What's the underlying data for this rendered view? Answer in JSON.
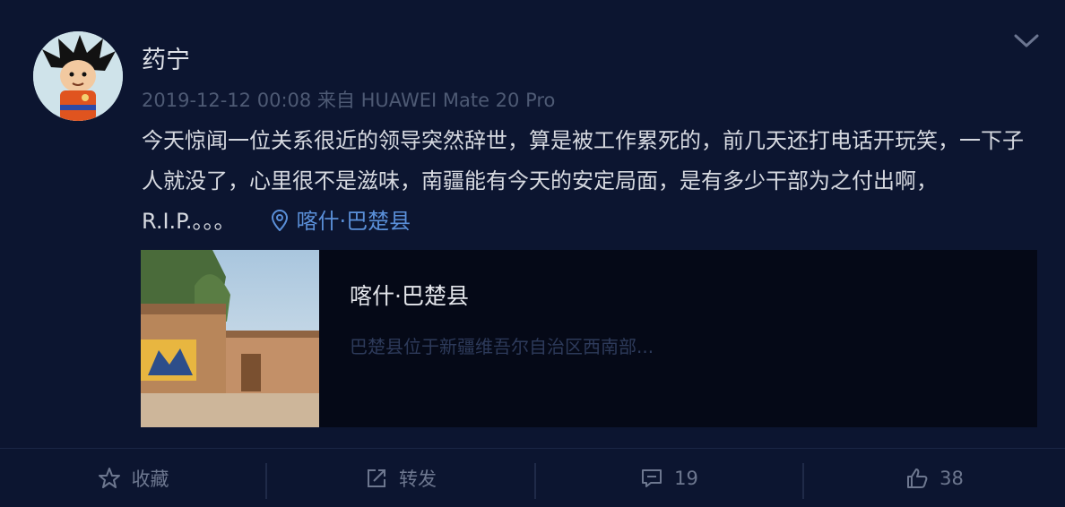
{
  "post": {
    "username": "药宁",
    "meta": "2019-12-12 00:08 来自 HUAWEI Mate 20 Pro",
    "text": "今天惊闻一位关系很近的领导突然辞世，算是被工作累死的，前几天还打电话开玩笑，一下子人就没了，心里很不是滋味，南疆能有今天的安定局面，是有多少干部为之付出啊，R.I.P.。。。",
    "location": "喀什·巴楚县"
  },
  "card": {
    "title": "喀什·巴楚县",
    "description": "巴楚县位于新疆维吾尔自治区西南部..."
  },
  "actions": {
    "favorite": "收藏",
    "repost": "转发",
    "comments": "19",
    "likes": "38"
  },
  "colors": {
    "background": "#0c1530",
    "link": "#5a8fd8",
    "muted": "#4e5a74"
  }
}
